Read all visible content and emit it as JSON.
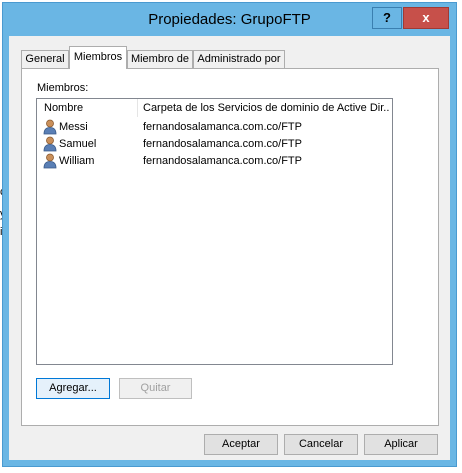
{
  "window": {
    "title": "Propiedades: GrupoFTP",
    "help_label": "?",
    "close_label": "x"
  },
  "background_fragments": [
    "c",
    "y",
    "ic"
  ],
  "tabs": [
    {
      "label": "General",
      "active": false
    },
    {
      "label": "Miembros",
      "active": true
    },
    {
      "label": "Miembro de",
      "active": false
    },
    {
      "label": "Administrado por",
      "active": false
    }
  ],
  "members": {
    "label": "Miembros:",
    "columns": [
      "Nombre",
      "Carpeta de los Servicios de dominio de Active Dir..."
    ],
    "rows": [
      {
        "name": "Messi",
        "folder": "fernandosalamanca.com.co/FTP",
        "icon": "user-icon"
      },
      {
        "name": "Samuel",
        "folder": "fernandosalamanca.com.co/FTP",
        "icon": "user-icon"
      },
      {
        "name": "William",
        "folder": "fernandosalamanca.com.co/FTP",
        "icon": "user-icon"
      }
    ],
    "add_button": "Agregar...",
    "remove_button": "Quitar"
  },
  "footer": {
    "ok": "Aceptar",
    "cancel": "Cancelar",
    "apply": "Aplicar"
  }
}
